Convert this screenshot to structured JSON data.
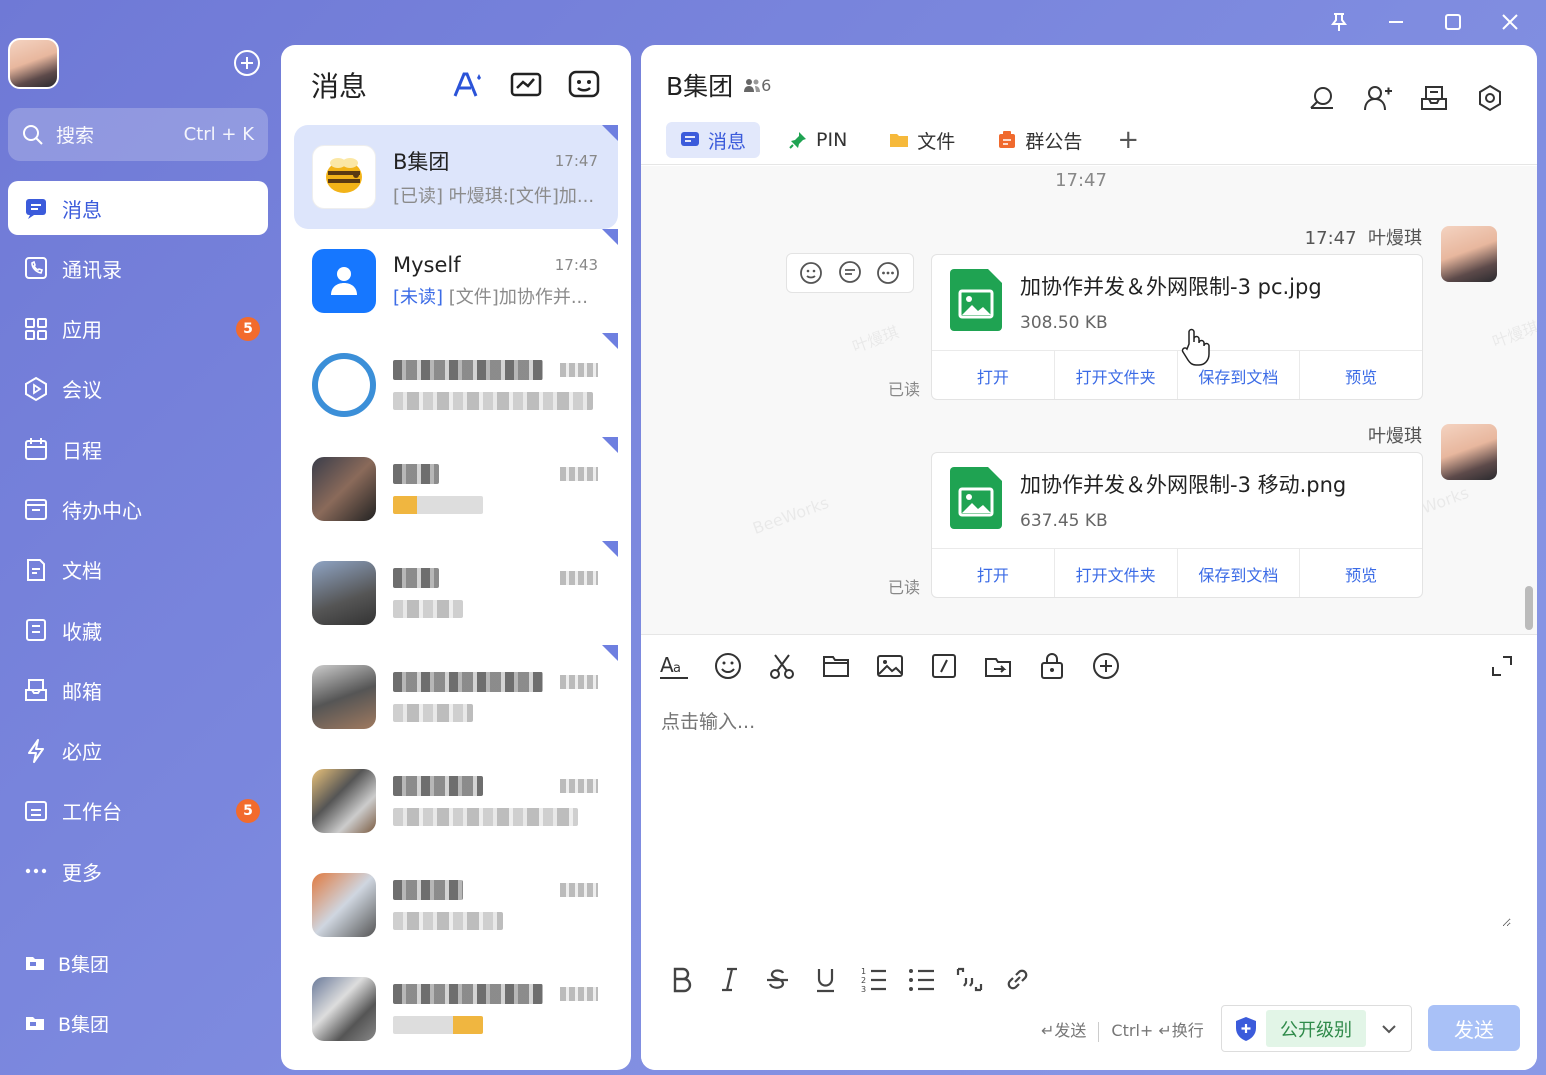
{
  "window_controls": {
    "pin": "pin-icon",
    "minimize": "minimize-icon",
    "maximize": "maximize-icon",
    "close": "close-icon"
  },
  "sidebar": {
    "search": {
      "placeholder": "搜索",
      "shortcut": "Ctrl + K"
    },
    "items": [
      {
        "label": "消息",
        "icon": "message-icon",
        "active": true
      },
      {
        "label": "通讯录",
        "icon": "contacts-icon"
      },
      {
        "label": "应用",
        "icon": "apps-icon",
        "badge": "5"
      },
      {
        "label": "会议",
        "icon": "meeting-icon"
      },
      {
        "label": "日程",
        "icon": "calendar-icon"
      },
      {
        "label": "待办中心",
        "icon": "todo-icon"
      },
      {
        "label": "文档",
        "icon": "docs-icon"
      },
      {
        "label": "收藏",
        "icon": "favorites-icon"
      },
      {
        "label": "邮箱",
        "icon": "mail-icon"
      },
      {
        "label": "必应",
        "icon": "bolt-icon"
      },
      {
        "label": "工作台",
        "icon": "workbench-icon",
        "badge": "5"
      },
      {
        "label": "更多",
        "icon": "more-icon"
      }
    ],
    "groups": [
      {
        "label": "B集团"
      },
      {
        "label": "B集团"
      }
    ]
  },
  "chat_list": {
    "title": "消息",
    "conversations": [
      {
        "name": "B集团",
        "time": "17:47",
        "preview": "[已读] 叶熳琪:[文件]加...",
        "active": true
      },
      {
        "name": "Myself",
        "time": "17:43",
        "tag": "[未读]",
        "preview": " [文件]加协作并..."
      }
    ]
  },
  "chat": {
    "title": "B集团",
    "member_count": "6",
    "tabs": [
      {
        "label": "消息",
        "active": true
      },
      {
        "label": "PIN"
      },
      {
        "label": "文件"
      },
      {
        "label": "群公告"
      }
    ],
    "time_separator": "17:47",
    "messages": [
      {
        "time": "17:47",
        "sender": "叶熳琪",
        "file_name": "加协作并发＆外网限制-3 pc.jpg",
        "file_size": "308.50 KB",
        "read": "已读",
        "actions": [
          "打开",
          "打开文件夹",
          "保存到文档",
          "预览"
        ]
      },
      {
        "sender": "叶熳琪",
        "file_name": "加协作并发＆外网限制-3 移动.png",
        "file_size": "637.45 KB",
        "read": "已读",
        "actions": [
          "打开",
          "打开文件夹",
          "保存到文档",
          "预览"
        ]
      }
    ],
    "composer": {
      "placeholder": "点击输入...",
      "send_hint": "↵发送",
      "newline_hint": "Ctrl+ ↵换行",
      "security_level": "公开级别",
      "send_label": "发送"
    }
  },
  "colors": {
    "accent": "#3b5bdb",
    "sidebar_bg": "#7280dc",
    "badge": "#f26b2d",
    "file_green": "#1fa352",
    "send_btn": "#a9c1f7"
  }
}
